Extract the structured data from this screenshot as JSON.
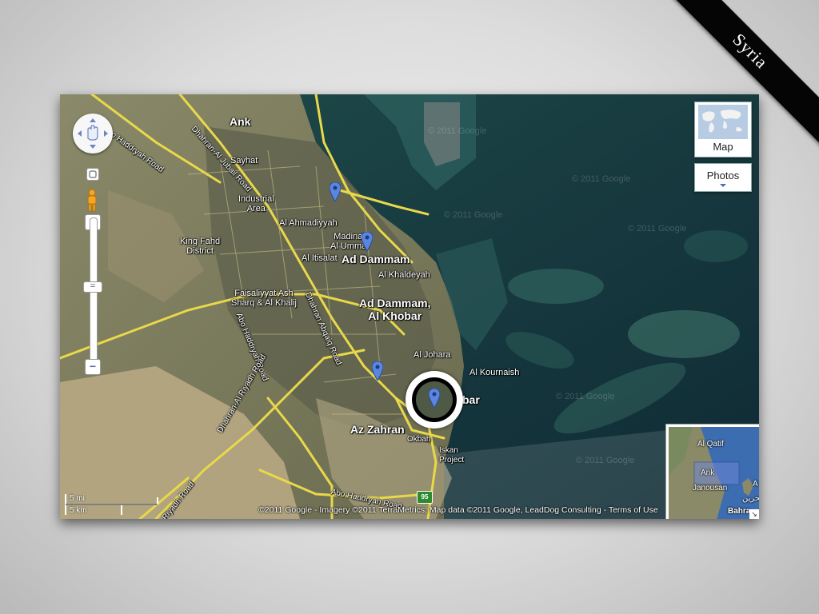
{
  "corner_ribbon": {
    "text": "Syria"
  },
  "map": {
    "places": {
      "ank": "Ank",
      "sayhat": "Sayhat",
      "industrial_area": "Industrial\nArea",
      "al_ahmadiyyah": "Al Ahmadiyyah",
      "madinat_al_ummal": "Madinat\nAl Ummal",
      "al_itisalat": "Al Itisalat",
      "ad_dammam": "Ad Dammam",
      "king_fahd_district": "King Fahd\nDistrict",
      "al_khaldeyah": "Al Khaldeyah",
      "faisaliyyat_ash_sharq": "Faisaliyyat Ash\nSharq & Al Khalij",
      "ad_dammam_al_khobar": "Ad Dammam,\nAl Khobar",
      "al_johara": "Al Johara",
      "al_kournaish": "Al Kournaish",
      "khobar_partial": "bar",
      "az_zahran": "Az Zahran",
      "okbah": "Okbah",
      "iskan_project": "Iskan\nProject",
      "abo_haddryah_road_top": "Abo Haddryah Road",
      "dhahran_al_jubail_road": "Dhahran-Al Jubail Road",
      "abo_haddryah_road_left": "Abo Haddryah Road",
      "dhahran_abqaiq_road": "Dhahran Abqaiq Road",
      "dhahran_al_riyadh_road": "Dhahran-Al Riyadh Road",
      "abo_haddryah_road_bottom": "Abo Haddryah Road",
      "riyadh_road": "Riyadh Road"
    },
    "watermark": "© 2011 Google",
    "route_shield": "95",
    "controls": {
      "pan_icon": "pan-control-icon",
      "zoom_in": "+",
      "zoom_out": "−",
      "slider_thumb": "=",
      "map_type_label": "Map",
      "photos_label": "Photos"
    },
    "overview": {
      "al_qatif": "Al Qatif",
      "ank": "Ank",
      "janousan": "Janousan",
      "bahrain": "Bahra",
      "arabic": "البحرين",
      "a": "A",
      "corner": "↘"
    },
    "scale": {
      "miles": "5 mi",
      "km": "5 km"
    },
    "attribution": {
      "text": "©2011 Google - Imagery ©2011 TerraMetrics, Map data ©2011 Google, LeadDog Consulting - ",
      "terms_link": "Terms of Use"
    }
  }
}
